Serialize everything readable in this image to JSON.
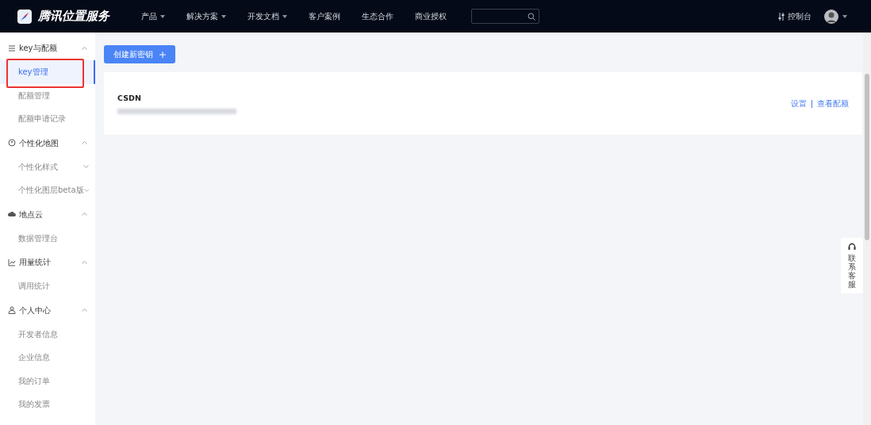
{
  "brand": {
    "name": "腾讯位置服务"
  },
  "nav": [
    {
      "label": "产品",
      "dropdown": true
    },
    {
      "label": "解决方案",
      "dropdown": true
    },
    {
      "label": "开发文档",
      "dropdown": true
    },
    {
      "label": "客户案例",
      "dropdown": false
    },
    {
      "label": "生态合作",
      "dropdown": false
    },
    {
      "label": "商业授权",
      "dropdown": false
    }
  ],
  "console": {
    "label": "控制台"
  },
  "sidebar": {
    "groups": [
      {
        "title": "key与配额",
        "expanded": true,
        "items": [
          {
            "label": "key管理",
            "selected": true,
            "highlighted": true,
            "expandable": false
          },
          {
            "label": "配额管理",
            "selected": false,
            "highlighted": false,
            "expandable": false
          },
          {
            "label": "配额申请记录",
            "selected": false,
            "highlighted": false,
            "expandable": false
          }
        ]
      },
      {
        "title": "个性化地图",
        "expanded": true,
        "items": [
          {
            "label": "个性化样式",
            "selected": false,
            "highlighted": false,
            "expandable": true
          },
          {
            "label": "个性化图层beta版",
            "selected": false,
            "highlighted": false,
            "expandable": true
          }
        ]
      },
      {
        "title": "地点云",
        "expanded": true,
        "items": [
          {
            "label": "数据管理台",
            "selected": false,
            "highlighted": false,
            "expandable": false
          }
        ]
      },
      {
        "title": "用量统计",
        "expanded": true,
        "items": [
          {
            "label": "调用统计",
            "selected": false,
            "highlighted": false,
            "expandable": false
          }
        ]
      },
      {
        "title": "个人中心",
        "expanded": true,
        "items": [
          {
            "label": "开发者信息",
            "selected": false,
            "highlighted": false,
            "expandable": false
          },
          {
            "label": "企业信息",
            "selected": false,
            "highlighted": false,
            "expandable": false
          },
          {
            "label": "我的订单",
            "selected": false,
            "highlighted": false,
            "expandable": false
          },
          {
            "label": "我的发票",
            "selected": false,
            "highlighted": false,
            "expandable": false
          }
        ]
      }
    ]
  },
  "create_button": {
    "label": "创建新密钥"
  },
  "keys": [
    {
      "name": "CSDN",
      "actions": [
        "设置",
        "查看配额"
      ]
    }
  ],
  "support": {
    "label": "联系客服"
  }
}
